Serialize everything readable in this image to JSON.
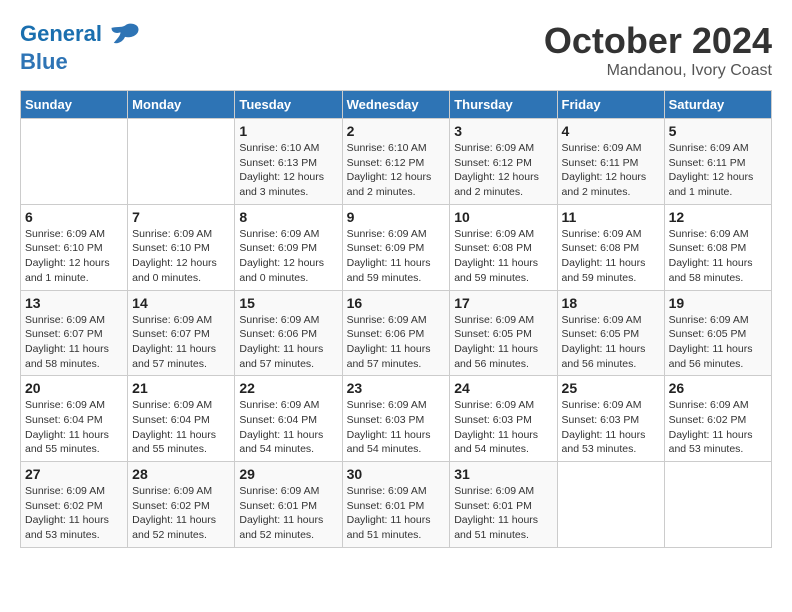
{
  "header": {
    "logo_line1": "General",
    "logo_line2": "Blue",
    "month": "October 2024",
    "location": "Mandanou, Ivory Coast"
  },
  "days_of_week": [
    "Sunday",
    "Monday",
    "Tuesday",
    "Wednesday",
    "Thursday",
    "Friday",
    "Saturday"
  ],
  "weeks": [
    [
      {
        "day": "",
        "info": ""
      },
      {
        "day": "",
        "info": ""
      },
      {
        "day": "1",
        "info": "Sunrise: 6:10 AM\nSunset: 6:13 PM\nDaylight: 12 hours and 3 minutes."
      },
      {
        "day": "2",
        "info": "Sunrise: 6:10 AM\nSunset: 6:12 PM\nDaylight: 12 hours and 2 minutes."
      },
      {
        "day": "3",
        "info": "Sunrise: 6:09 AM\nSunset: 6:12 PM\nDaylight: 12 hours and 2 minutes."
      },
      {
        "day": "4",
        "info": "Sunrise: 6:09 AM\nSunset: 6:11 PM\nDaylight: 12 hours and 2 minutes."
      },
      {
        "day": "5",
        "info": "Sunrise: 6:09 AM\nSunset: 6:11 PM\nDaylight: 12 hours and 1 minute."
      }
    ],
    [
      {
        "day": "6",
        "info": "Sunrise: 6:09 AM\nSunset: 6:10 PM\nDaylight: 12 hours and 1 minute."
      },
      {
        "day": "7",
        "info": "Sunrise: 6:09 AM\nSunset: 6:10 PM\nDaylight: 12 hours and 0 minutes."
      },
      {
        "day": "8",
        "info": "Sunrise: 6:09 AM\nSunset: 6:09 PM\nDaylight: 12 hours and 0 minutes."
      },
      {
        "day": "9",
        "info": "Sunrise: 6:09 AM\nSunset: 6:09 PM\nDaylight: 11 hours and 59 minutes."
      },
      {
        "day": "10",
        "info": "Sunrise: 6:09 AM\nSunset: 6:08 PM\nDaylight: 11 hours and 59 minutes."
      },
      {
        "day": "11",
        "info": "Sunrise: 6:09 AM\nSunset: 6:08 PM\nDaylight: 11 hours and 59 minutes."
      },
      {
        "day": "12",
        "info": "Sunrise: 6:09 AM\nSunset: 6:08 PM\nDaylight: 11 hours and 58 minutes."
      }
    ],
    [
      {
        "day": "13",
        "info": "Sunrise: 6:09 AM\nSunset: 6:07 PM\nDaylight: 11 hours and 58 minutes."
      },
      {
        "day": "14",
        "info": "Sunrise: 6:09 AM\nSunset: 6:07 PM\nDaylight: 11 hours and 57 minutes."
      },
      {
        "day": "15",
        "info": "Sunrise: 6:09 AM\nSunset: 6:06 PM\nDaylight: 11 hours and 57 minutes."
      },
      {
        "day": "16",
        "info": "Sunrise: 6:09 AM\nSunset: 6:06 PM\nDaylight: 11 hours and 57 minutes."
      },
      {
        "day": "17",
        "info": "Sunrise: 6:09 AM\nSunset: 6:05 PM\nDaylight: 11 hours and 56 minutes."
      },
      {
        "day": "18",
        "info": "Sunrise: 6:09 AM\nSunset: 6:05 PM\nDaylight: 11 hours and 56 minutes."
      },
      {
        "day": "19",
        "info": "Sunrise: 6:09 AM\nSunset: 6:05 PM\nDaylight: 11 hours and 56 minutes."
      }
    ],
    [
      {
        "day": "20",
        "info": "Sunrise: 6:09 AM\nSunset: 6:04 PM\nDaylight: 11 hours and 55 minutes."
      },
      {
        "day": "21",
        "info": "Sunrise: 6:09 AM\nSunset: 6:04 PM\nDaylight: 11 hours and 55 minutes."
      },
      {
        "day": "22",
        "info": "Sunrise: 6:09 AM\nSunset: 6:04 PM\nDaylight: 11 hours and 54 minutes."
      },
      {
        "day": "23",
        "info": "Sunrise: 6:09 AM\nSunset: 6:03 PM\nDaylight: 11 hours and 54 minutes."
      },
      {
        "day": "24",
        "info": "Sunrise: 6:09 AM\nSunset: 6:03 PM\nDaylight: 11 hours and 54 minutes."
      },
      {
        "day": "25",
        "info": "Sunrise: 6:09 AM\nSunset: 6:03 PM\nDaylight: 11 hours and 53 minutes."
      },
      {
        "day": "26",
        "info": "Sunrise: 6:09 AM\nSunset: 6:02 PM\nDaylight: 11 hours and 53 minutes."
      }
    ],
    [
      {
        "day": "27",
        "info": "Sunrise: 6:09 AM\nSunset: 6:02 PM\nDaylight: 11 hours and 53 minutes."
      },
      {
        "day": "28",
        "info": "Sunrise: 6:09 AM\nSunset: 6:02 PM\nDaylight: 11 hours and 52 minutes."
      },
      {
        "day": "29",
        "info": "Sunrise: 6:09 AM\nSunset: 6:01 PM\nDaylight: 11 hours and 52 minutes."
      },
      {
        "day": "30",
        "info": "Sunrise: 6:09 AM\nSunset: 6:01 PM\nDaylight: 11 hours and 51 minutes."
      },
      {
        "day": "31",
        "info": "Sunrise: 6:09 AM\nSunset: 6:01 PM\nDaylight: 11 hours and 51 minutes."
      },
      {
        "day": "",
        "info": ""
      },
      {
        "day": "",
        "info": ""
      }
    ]
  ]
}
